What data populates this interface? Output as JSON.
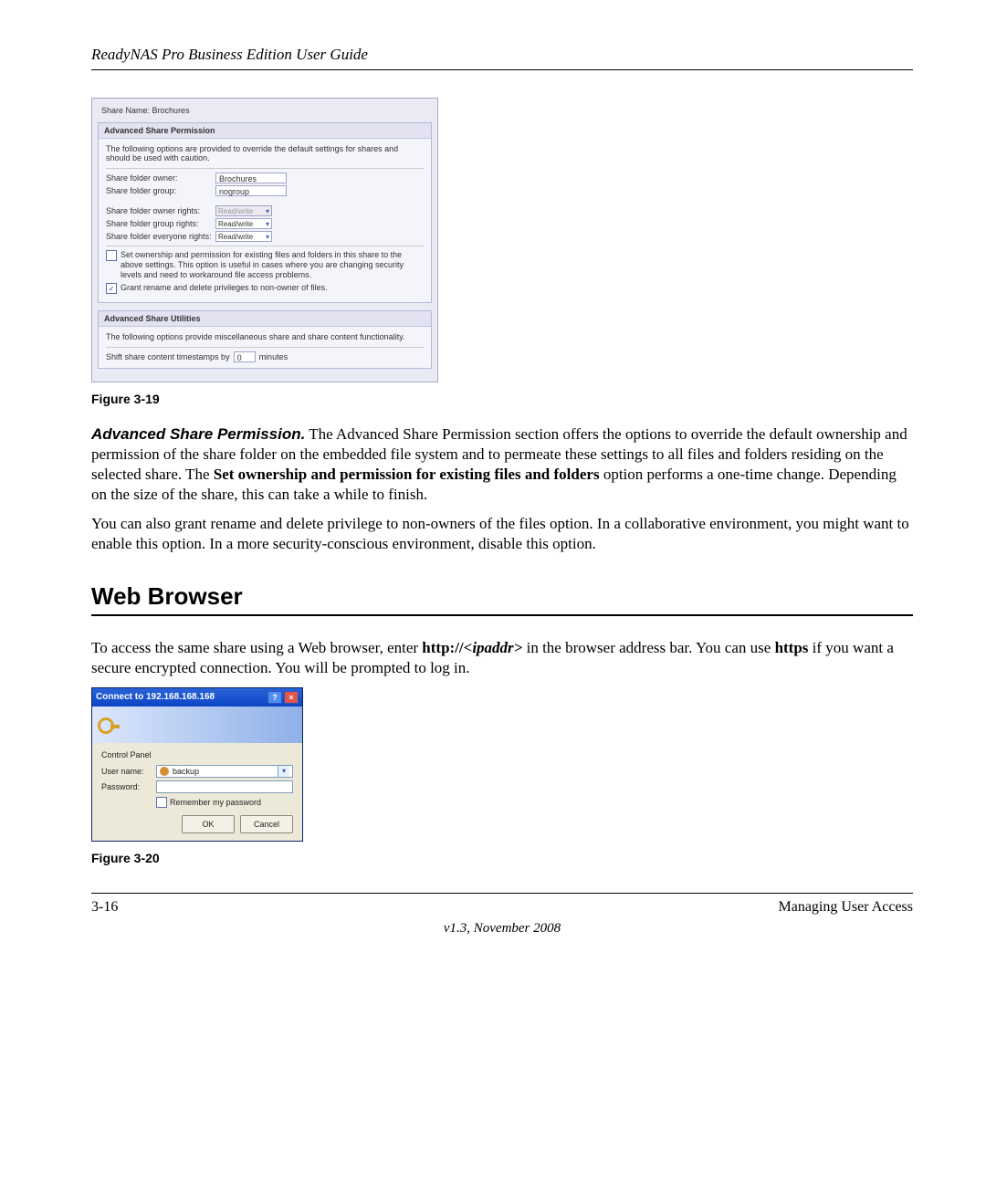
{
  "header": {
    "title": "ReadyNAS Pro Business Edition User Guide"
  },
  "dialog": {
    "share_name_label": "Share Name:",
    "share_name_value": "Brochures",
    "adv_perm": {
      "title": "Advanced Share Permission",
      "note": "The following options are provided to override the default settings for shares and should be used with caution.",
      "owner_label": "Share folder owner:",
      "owner_value": "Brochures",
      "group_label": "Share folder group:",
      "group_value": "nogroup",
      "owner_rights_label": "Share folder owner rights:",
      "owner_rights_value": "Read/write",
      "group_rights_label": "Share folder group rights:",
      "group_rights_value": "Read/write",
      "everyone_rights_label": "Share folder everyone rights:",
      "everyone_rights_value": "Read/write",
      "set_ownership_checked": false,
      "set_ownership_text": "Set ownership and permission for existing files and folders in this share to the above settings. This option is useful in cases where you are changing security levels and need to workaround file access problems.",
      "grant_rename_checked": true,
      "grant_rename_text": "Grant rename and delete privileges to non-owner of files."
    },
    "adv_util": {
      "title": "Advanced Share Utilities",
      "note": "The following options provide miscellaneous share and share content functionality.",
      "shift_label_pre": "Shift share content timestamps by",
      "shift_value": "0",
      "shift_label_post": "minutes"
    }
  },
  "fig19": "Figure 3-19",
  "para1": {
    "lead": "Advanced Share Permission.",
    "text": " The Advanced Share Permission section offers the options to override the default ownership and permission of the share folder on the embedded file system and to permeate these settings to all files and folders residing on the selected share. The ",
    "bold1": "Set ownership and permission for existing files and folders",
    "text2": " option performs a one-time change. Depending on the size of the share, this can take a while to finish."
  },
  "para2": "You can also grant rename and delete privilege to non-owners of the files option. In a collaborative environment, you might want to enable this option. In a more security-conscious environment, disable this option.",
  "section_heading": "Web Browser",
  "para3": {
    "t1": "To access the same share using a Web browser, enter ",
    "b1": "http://",
    "bi1": "<ipaddr>",
    "t2": " in the browser address bar. You can use ",
    "b2": "https",
    "t3": " if you want a secure encrypted connection. You will be prompted to log in."
  },
  "login": {
    "title": "Connect to 192.168.168.168",
    "section": "Control Panel",
    "user_label": "User name:",
    "user_value": "backup",
    "pass_label": "Password:",
    "remember": "Remember my password",
    "ok": "OK",
    "cancel": "Cancel"
  },
  "fig20": "Figure 3-20",
  "footer": {
    "left": "3-16",
    "right": "Managing User Access",
    "center": "v1.3, November 2008"
  }
}
